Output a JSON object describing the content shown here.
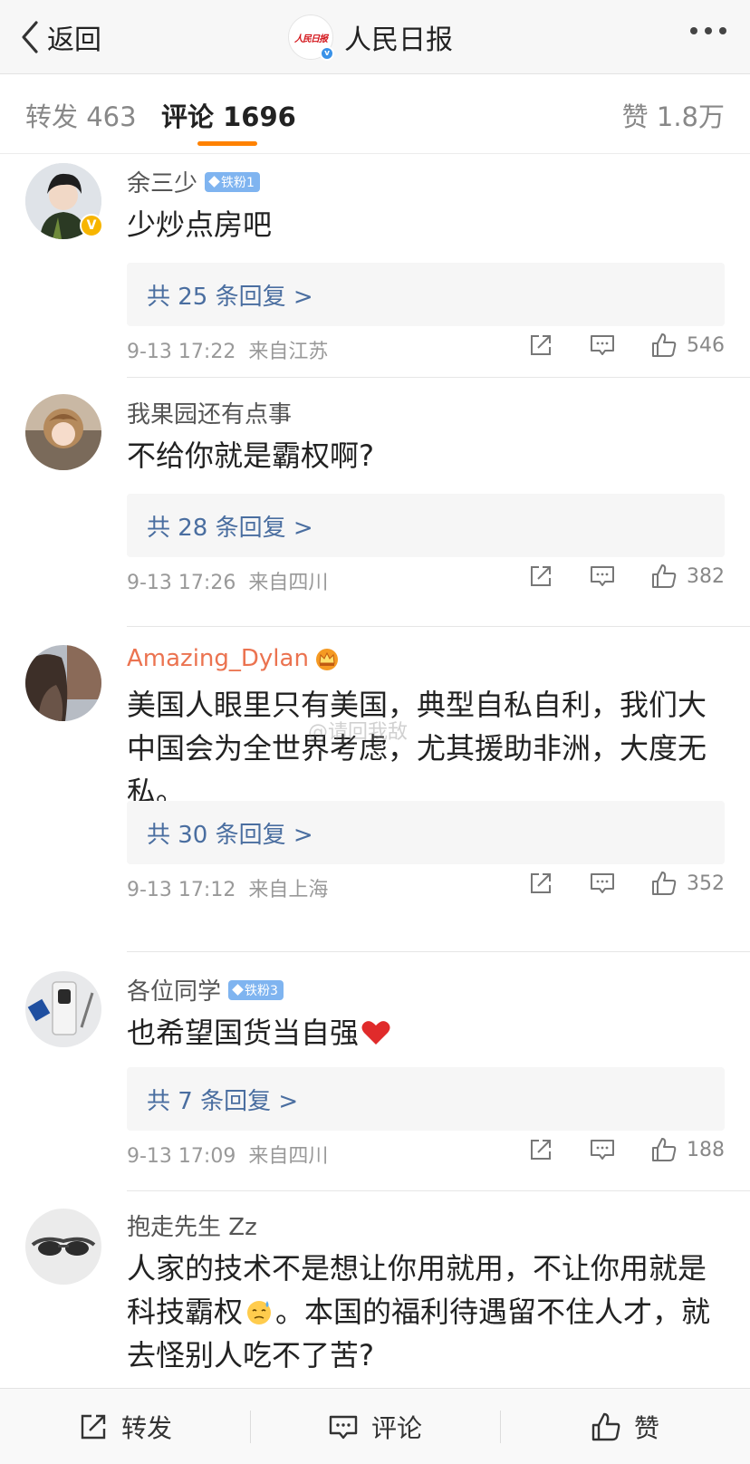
{
  "nav": {
    "back_label": "返回",
    "logo_text": "人民日报",
    "title": "人民日报"
  },
  "tabs": {
    "repost": "转发 463",
    "comments": "评论 1696",
    "likes": "赞 1.8万"
  },
  "watermark": "@请回我敌",
  "comments": [
    {
      "user": "余三少",
      "badge": "铁粉1",
      "text": "少炒点房吧",
      "replies": "共 25 条回复 >",
      "time": "9-13 17:22",
      "location": "来自江苏",
      "likes": "546"
    },
    {
      "user": "我果园还有点事",
      "text": "不给你就是霸权啊?",
      "replies": "共 28 条回复 >",
      "time": "9-13 17:26",
      "location": "来自四川",
      "likes": "382"
    },
    {
      "user": "Amazing_Dylan",
      "text": "美国人眼里只有美国，典型自私自利，我们大中国会为全世界考虑，尤其援助非洲，大度无私。",
      "replies": "共 30 条回复 >",
      "time": "9-13 17:12",
      "location": "来自上海",
      "likes": "352"
    },
    {
      "user": "各位同学",
      "badge": "铁粉3",
      "text": "也希望国货当自强",
      "replies": "共 7 条回复 >",
      "time": "9-13 17:09",
      "location": "来自四川",
      "likes": "188"
    },
    {
      "user": "抱走先生 Zz",
      "text_part1": "人家的技术不是想让你用就用，不让你用就是科技霸权",
      "text_part2": "。本国的福利待遇留不住人才，就去怪别人吃不了苦?"
    }
  ],
  "bottom": {
    "repost": "转发",
    "comment": "评论",
    "like": "赞"
  },
  "colors": {
    "accent": "#ff8200",
    "reply_link": "#4a6ea0",
    "vip_name": "#eb7350",
    "fan_badge": "#7fb4f0"
  }
}
